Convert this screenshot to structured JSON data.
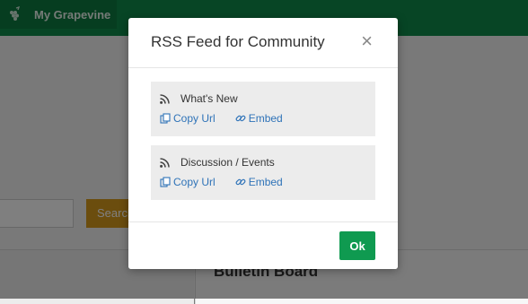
{
  "background": {
    "nav": {
      "brand_label": "My Grapevine"
    },
    "search_button_label": "Search",
    "panel_title": "Bulletin Board"
  },
  "modal": {
    "title": "RSS Feed for Community",
    "close_glyph": "×",
    "feeds": [
      {
        "title": "What's New",
        "copy_label": "Copy Url",
        "embed_label": "Embed"
      },
      {
        "title": "Discussion / Events",
        "copy_label": "Copy Url",
        "embed_label": "Embed"
      }
    ],
    "ok_label": "Ok"
  },
  "colors": {
    "brand_green": "#0f8a4a",
    "ok_green": "#0f9a50",
    "link_blue": "#2f73b8",
    "search_orange": "#d79a1c"
  },
  "icons": [
    "grapevine-logo-icon",
    "rss-icon",
    "copy-icon",
    "link-icon"
  ]
}
